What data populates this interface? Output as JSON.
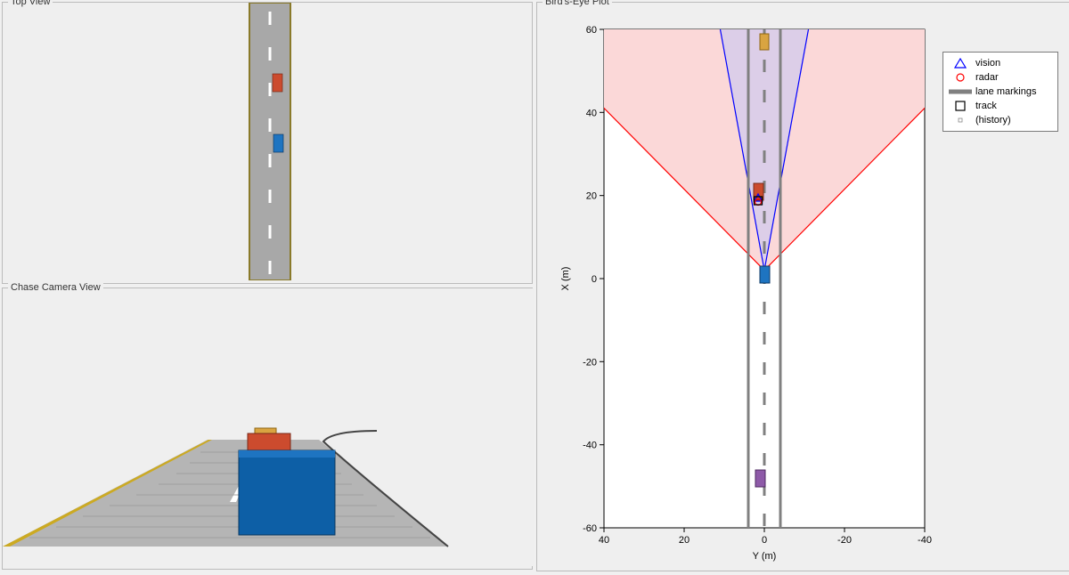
{
  "panels": {
    "top_view_title": "Top View",
    "chase_view_title": "Chase Camera View",
    "bep_title": "Bird's-Eye Plot"
  },
  "legend": {
    "vision": "vision",
    "radar": "radar",
    "lane": "lane markings",
    "track": "track",
    "history": "(history)"
  },
  "axes": {
    "xlabel": "Y (m)",
    "ylabel": "X (m)"
  },
  "ticks": {
    "x": [
      "40",
      "20",
      "0",
      "-20",
      "-40"
    ],
    "y": [
      "-60",
      "-40",
      "-20",
      "0",
      "20",
      "40",
      "60"
    ]
  },
  "chart_data": {
    "type": "scatter",
    "title": "Bird's-Eye Plot",
    "xlabel": "Y (m)",
    "ylabel": "X (m)",
    "x_range": [
      40,
      -40
    ],
    "y_range": [
      -60,
      60
    ],
    "x_ticks": [
      40,
      20,
      0,
      -20,
      -40
    ],
    "y_ticks": [
      -60,
      -40,
      -20,
      0,
      20,
      40,
      60
    ],
    "lane": {
      "left_edge_y": 4,
      "right_edge_y": -4,
      "center_dashed_y": 0
    },
    "sensor_cones": [
      {
        "name": "radar",
        "color": "#ffd5d5",
        "apex": {
          "y": 0,
          "x": 2
        },
        "rays_to": [
          {
            "y": 40,
            "x": 41
          },
          {
            "y": -40,
            "x": 41
          }
        ]
      },
      {
        "name": "vision",
        "color": "#d6cceb",
        "apex": {
          "y": 0,
          "x": 2
        },
        "rays_to": [
          {
            "y": 11,
            "x": 60
          },
          {
            "y": -11,
            "x": 60
          }
        ]
      }
    ],
    "legend": [
      {
        "marker": "triangle",
        "color": "#0000ff",
        "label": "vision"
      },
      {
        "marker": "circle",
        "color": "#ff0000",
        "label": "radar"
      },
      {
        "marker": "line",
        "color": "#808080",
        "label": "lane markings"
      },
      {
        "marker": "square",
        "color": "#000000",
        "label": "track"
      },
      {
        "marker": "dot",
        "color": "#888888",
        "label": "(history)"
      }
    ],
    "series": [
      {
        "name": "ego",
        "color": "#1e74c1",
        "points": [
          {
            "y": 0,
            "x": 1
          }
        ]
      },
      {
        "name": "lead_car_red",
        "color": "#cc4b2e",
        "points": [
          {
            "y": 1.5,
            "x": 21
          }
        ]
      },
      {
        "name": "far_car_orange",
        "color": "#d9a441",
        "points": [
          {
            "y": 0,
            "x": 57
          }
        ]
      },
      {
        "name": "rear_car_purple",
        "color": "#8e5aa8",
        "points": [
          {
            "y": 1,
            "x": -48
          }
        ]
      },
      {
        "name": "vision_detection",
        "marker": "triangle",
        "color": "#0000ff",
        "points": [
          {
            "y": 1.5,
            "x": 19.5
          }
        ]
      },
      {
        "name": "radar_detection",
        "marker": "circle",
        "color": "#ff0000",
        "points": [
          {
            "y": 1.5,
            "x": 19
          }
        ]
      },
      {
        "name": "track",
        "marker": "square",
        "color": "#000000",
        "points": [
          {
            "y": 1.5,
            "x": 19
          }
        ]
      }
    ]
  },
  "top_view_scene": {
    "road_width_m": 8,
    "cars": [
      {
        "name": "ego",
        "color": "#1e74c1",
        "lane": "right",
        "x_m": 0
      },
      {
        "name": "lead",
        "color": "#cc4b2e",
        "lane": "right",
        "x_m": 20
      },
      {
        "name": "far",
        "color": "#d9a441",
        "lane": "left",
        "x_m": 57
      },
      {
        "name": "rear",
        "color": "#8e5aa8",
        "lane": "right",
        "x_m": -48
      }
    ]
  }
}
